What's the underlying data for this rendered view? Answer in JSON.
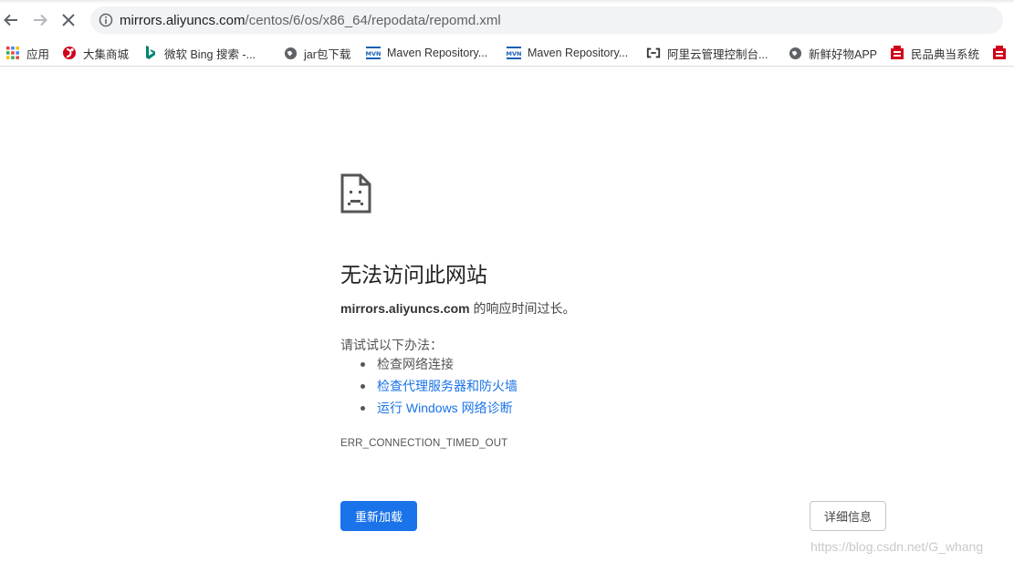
{
  "toolbar": {
    "url_host": "mirrors.aliyuncs.com",
    "url_path": "/centos/6/os/x86_64/repodata/repomd.xml",
    "back_icon": "arrow-left-icon",
    "forward_icon": "arrow-right-icon",
    "stop_icon": "close-icon",
    "info_icon": "info-icon"
  },
  "bookmarks": [
    {
      "label": "应用",
      "icon": "apps-grid-icon"
    },
    {
      "label": "大集商城",
      "icon": "store-icon"
    },
    {
      "label": "微软 Bing 搜索 -...",
      "icon": "bing-icon"
    },
    {
      "label": "jar包下载",
      "icon": "globe-icon"
    },
    {
      "label": "Maven Repository...",
      "icon": "mvn-icon"
    },
    {
      "label": "Maven Repository...",
      "icon": "mvn-icon"
    },
    {
      "label": "阿里云管理控制台...",
      "icon": "aliyun-icon"
    },
    {
      "label": "新鲜好物APP",
      "icon": "globe-icon"
    },
    {
      "label": "民品典当系统",
      "icon": "pawn-icon"
    }
  ],
  "error": {
    "icon": "sad-document-icon",
    "title": "无法访问此网站",
    "host": "mirrors.aliyuncs.com",
    "description_suffix": " 的响应时间过长。",
    "try_label": "请试试以下办法：",
    "suggestions": [
      {
        "text": "检查网络连接",
        "link": false
      },
      {
        "text": "检查代理服务器和防火墙",
        "link": true
      },
      {
        "text": "运行 Windows 网络诊断",
        "link": true
      }
    ],
    "code": "ERR_CONNECTION_TIMED_OUT",
    "reload_label": "重新加载",
    "details_label": "详细信息"
  },
  "watermark": "https://blog.csdn.net/G_whang",
  "colors": {
    "link": "#1a73e8",
    "primary_button": "#1a73e8"
  }
}
